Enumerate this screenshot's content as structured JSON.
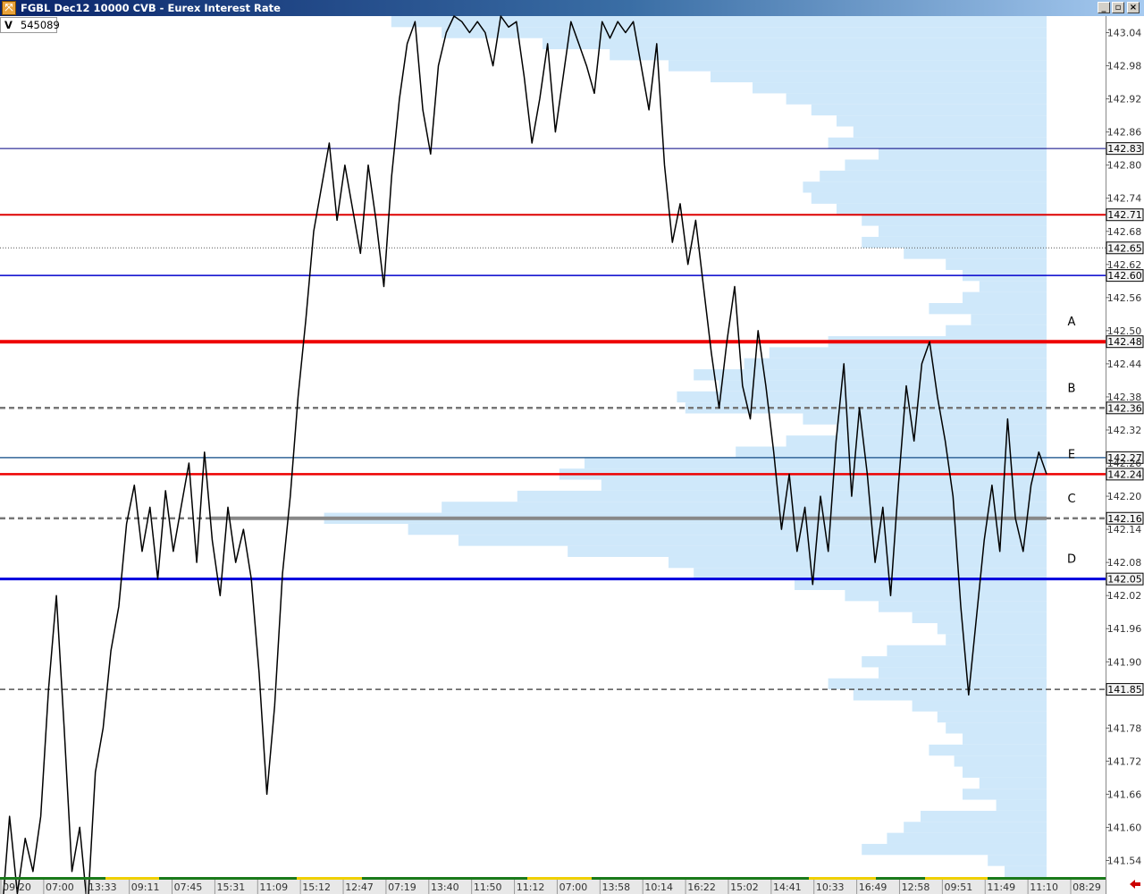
{
  "window": {
    "title": "FGBL Dec12 10000 CVB - Eurex Interest Rate",
    "minimize_glyph": "_",
    "maximize_glyph": "▫",
    "close_glyph": "×"
  },
  "volume_label": {
    "prefix": "V",
    "value": "545089"
  },
  "chart_data": {
    "type": "line",
    "instrument": "FGBL Dec12",
    "series": [
      {
        "points": [
          [
            "09:20",
            141.44
          ],
          [
            "09:20",
            141.62
          ],
          [
            "09:20",
            141.48
          ],
          [
            "09:20",
            141.58
          ],
          [
            "09:20",
            141.52
          ],
          [
            "07:00",
            141.62
          ],
          [
            "07:00",
            141.85
          ],
          [
            "07:00",
            142.02
          ],
          [
            "07:00",
            141.78
          ],
          [
            "07:00",
            141.52
          ],
          [
            "07:00",
            141.6
          ],
          [
            "07:00",
            141.45
          ],
          [
            "07:00",
            141.7
          ],
          [
            "13:33",
            141.78
          ],
          [
            "13:33",
            141.92
          ],
          [
            "13:33",
            142.0
          ],
          [
            "13:33",
            142.15
          ],
          [
            "13:33",
            142.22
          ],
          [
            "13:33",
            142.1
          ],
          [
            "13:33",
            142.18
          ],
          [
            "09:11",
            142.05
          ],
          [
            "09:11",
            142.21
          ],
          [
            "09:11",
            142.1
          ],
          [
            "09:11",
            142.18
          ],
          [
            "09:11",
            142.26
          ],
          [
            "09:11",
            142.08
          ],
          [
            "07:45",
            142.28
          ],
          [
            "07:45",
            142.12
          ],
          [
            "07:45",
            142.02
          ],
          [
            "07:45",
            142.18
          ],
          [
            "07:45",
            142.08
          ],
          [
            "15:31",
            142.14
          ],
          [
            "15:31",
            142.05
          ],
          [
            "15:31",
            141.88
          ],
          [
            "15:31",
            141.66
          ],
          [
            "15:31",
            141.82
          ],
          [
            "15:31",
            142.06
          ],
          [
            "15:31",
            142.2
          ],
          [
            "11:09",
            142.38
          ],
          [
            "11:09",
            142.52
          ],
          [
            "11:09",
            142.68
          ],
          [
            "11:09",
            142.76
          ],
          [
            "11:09",
            142.84
          ],
          [
            "11:09",
            142.7
          ],
          [
            "15:12",
            142.8
          ],
          [
            "15:12",
            142.72
          ],
          [
            "15:12",
            142.64
          ],
          [
            "15:12",
            142.8
          ],
          [
            "15:12",
            142.7
          ],
          [
            "12:47",
            142.58
          ],
          [
            "12:47",
            142.78
          ],
          [
            "12:47",
            142.92
          ],
          [
            "12:47",
            143.02
          ],
          [
            "12:47",
            143.06
          ],
          [
            "12:47",
            142.9
          ],
          [
            "07:19",
            142.82
          ],
          [
            "07:19",
            142.98
          ],
          [
            "07:19",
            143.04
          ],
          [
            "07:19",
            143.07
          ],
          [
            "13:40",
            143.06
          ],
          [
            "13:40",
            143.04
          ],
          [
            "11:50",
            143.06
          ],
          [
            "11:50",
            143.04
          ],
          [
            "11:50",
            142.98
          ],
          [
            "11:12",
            143.07
          ],
          [
            "11:12",
            143.05
          ],
          [
            "07:00",
            143.06
          ],
          [
            "07:00",
            142.96
          ],
          [
            "07:00",
            142.84
          ],
          [
            "07:00",
            142.92
          ],
          [
            "13:58",
            143.02
          ],
          [
            "13:58",
            142.86
          ],
          [
            "13:58",
            142.96
          ],
          [
            "10:14",
            143.06
          ],
          [
            "10:14",
            143.02
          ],
          [
            "10:14",
            142.98
          ],
          [
            "10:14",
            142.93
          ],
          [
            "16:22",
            143.06
          ],
          [
            "16:22",
            143.03
          ],
          [
            "15:02",
            143.06
          ],
          [
            "15:02",
            143.04
          ],
          [
            "14:41",
            143.06
          ],
          [
            "14:41",
            142.98
          ],
          [
            "14:41",
            142.9
          ],
          [
            "14:41",
            143.02
          ],
          [
            "10:33",
            142.8
          ],
          [
            "10:33",
            142.66
          ],
          [
            "10:33",
            142.73
          ],
          [
            "10:33",
            142.62
          ],
          [
            "10:33",
            142.7
          ],
          [
            "16:49",
            142.58
          ],
          [
            "16:49",
            142.46
          ],
          [
            "16:49",
            142.36
          ],
          [
            "16:49",
            142.48
          ],
          [
            "16:49",
            142.58
          ],
          [
            "16:49",
            142.4
          ],
          [
            "16:49",
            142.34
          ],
          [
            "16:49",
            142.5
          ],
          [
            "16:49",
            142.4
          ],
          [
            "12:58",
            142.28
          ],
          [
            "12:58",
            142.14
          ],
          [
            "12:58",
            142.24
          ],
          [
            "12:58",
            142.1
          ],
          [
            "12:58",
            142.18
          ],
          [
            "12:58",
            142.04
          ],
          [
            "12:58",
            142.2
          ],
          [
            "12:58",
            142.1
          ],
          [
            "09:51",
            142.3
          ],
          [
            "09:51",
            142.44
          ],
          [
            "09:51",
            142.2
          ],
          [
            "09:51",
            142.36
          ],
          [
            "09:51",
            142.24
          ],
          [
            "11:49",
            142.08
          ],
          [
            "11:49",
            142.18
          ],
          [
            "11:49",
            142.02
          ],
          [
            "11:49",
            142.22
          ],
          [
            "11:49",
            142.4
          ],
          [
            "11:49",
            142.3
          ],
          [
            "11:49",
            142.44
          ],
          [
            "11:49",
            142.48
          ],
          [
            "11:49",
            142.38
          ],
          [
            "11:49",
            142.3
          ],
          [
            "11:10",
            142.2
          ],
          [
            "11:10",
            142.0
          ],
          [
            "11:10",
            141.84
          ],
          [
            "11:10",
            141.98
          ],
          [
            "11:10",
            142.12
          ],
          [
            "11:10",
            142.22
          ],
          [
            "11:10",
            142.1
          ],
          [
            "08:29",
            142.34
          ],
          [
            "08:29",
            142.16
          ],
          [
            "08:29",
            142.1
          ],
          [
            "08:29",
            142.22
          ],
          [
            "08:29",
            142.28
          ],
          [
            "08:29",
            142.24
          ]
        ]
      }
    ],
    "x_labels": [
      "09:20",
      "07:00",
      "13:33",
      "09:11",
      "07:45",
      "15:31",
      "11:09",
      "15:12",
      "12:47",
      "07:19",
      "13:40",
      "11:50",
      "11:12",
      "07:00",
      "13:58",
      "10:14",
      "16:22",
      "15:02",
      "14:41",
      "10:33",
      "16:49",
      "12:58",
      "09:51",
      "11:49",
      "11:10",
      "08:29"
    ],
    "y_ticks": [
      "143.04",
      "142.98",
      "142.92",
      "142.86",
      "142.80",
      "142.74",
      "142.68",
      "142.62",
      "142.56",
      "142.50",
      "142.44",
      "142.38",
      "142.32",
      "142.26",
      "142.20",
      "142.14",
      "142.08",
      "142.02",
      "141.96",
      "141.90",
      "141.78",
      "141.72",
      "141.66",
      "141.60",
      "141.54"
    ],
    "ylim": [
      141.51,
      143.07
    ],
    "volume_profile": [
      [
        143.06,
        0.78
      ],
      [
        143.04,
        0.72
      ],
      [
        143.02,
        0.6
      ],
      [
        143.0,
        0.52
      ],
      [
        142.98,
        0.45
      ],
      [
        142.96,
        0.4
      ],
      [
        142.94,
        0.35
      ],
      [
        142.92,
        0.31
      ],
      [
        142.9,
        0.28
      ],
      [
        142.88,
        0.25
      ],
      [
        142.86,
        0.23
      ],
      [
        142.84,
        0.26
      ],
      [
        142.82,
        0.2
      ],
      [
        142.8,
        0.24
      ],
      [
        142.78,
        0.27
      ],
      [
        142.76,
        0.29
      ],
      [
        142.74,
        0.28
      ],
      [
        142.72,
        0.25
      ],
      [
        142.7,
        0.22
      ],
      [
        142.68,
        0.2
      ],
      [
        142.66,
        0.22
      ],
      [
        142.64,
        0.17
      ],
      [
        142.62,
        0.12
      ],
      [
        142.6,
        0.1
      ],
      [
        142.58,
        0.08
      ],
      [
        142.56,
        0.1
      ],
      [
        142.54,
        0.14
      ],
      [
        142.52,
        0.09
      ],
      [
        142.5,
        0.12
      ],
      [
        142.48,
        0.26
      ],
      [
        142.46,
        0.33
      ],
      [
        142.44,
        0.36
      ],
      [
        142.42,
        0.42
      ],
      [
        142.4,
        0.39
      ],
      [
        142.38,
        0.44
      ],
      [
        142.36,
        0.43
      ],
      [
        142.34,
        0.29
      ],
      [
        142.32,
        0.25
      ],
      [
        142.3,
        0.31
      ],
      [
        142.28,
        0.37
      ],
      [
        142.26,
        0.55
      ],
      [
        142.24,
        0.58
      ],
      [
        142.22,
        0.53
      ],
      [
        142.2,
        0.63
      ],
      [
        142.18,
        0.72
      ],
      [
        142.16,
        0.86
      ],
      [
        142.14,
        0.76
      ],
      [
        142.12,
        0.7
      ],
      [
        142.1,
        0.57
      ],
      [
        142.08,
        0.45
      ],
      [
        142.06,
        0.42
      ],
      [
        142.04,
        0.3
      ],
      [
        142.02,
        0.24
      ],
      [
        142.0,
        0.2
      ],
      [
        141.98,
        0.16
      ],
      [
        141.96,
        0.13
      ],
      [
        141.94,
        0.12
      ],
      [
        141.92,
        0.19
      ],
      [
        141.9,
        0.22
      ],
      [
        141.88,
        0.2
      ],
      [
        141.86,
        0.26
      ],
      [
        141.84,
        0.23
      ],
      [
        141.82,
        0.16
      ],
      [
        141.8,
        0.13
      ],
      [
        141.78,
        0.12
      ],
      [
        141.76,
        0.1
      ],
      [
        141.74,
        0.14
      ],
      [
        141.72,
        0.11
      ],
      [
        141.7,
        0.1
      ],
      [
        141.68,
        0.08
      ],
      [
        141.66,
        0.1
      ],
      [
        141.64,
        0.06
      ],
      [
        141.62,
        0.15
      ],
      [
        141.6,
        0.17
      ],
      [
        141.58,
        0.19
      ],
      [
        141.56,
        0.22
      ],
      [
        141.54,
        0.07
      ],
      [
        141.52,
        0.05
      ]
    ],
    "levels": [
      {
        "price": 142.83,
        "label": "142.83",
        "color": "#000080",
        "style": "solid",
        "weight": 1,
        "tag": ""
      },
      {
        "price": 142.71,
        "label": "142.71",
        "color": "#dd0000",
        "style": "solid",
        "weight": 2,
        "tag": ""
      },
      {
        "price": 142.65,
        "label": "142.65",
        "color": "#555555",
        "style": "dotted",
        "weight": 1,
        "tag": ""
      },
      {
        "price": 142.6,
        "label": "142.60",
        "color": "#0000cc",
        "style": "solid",
        "weight": 1.5,
        "tag": ""
      },
      {
        "price": 142.48,
        "label": "142.48",
        "color": "#ee0000",
        "style": "solid",
        "weight": 4,
        "tag": "A"
      },
      {
        "price": 142.36,
        "label": "142.36",
        "color": "#777777",
        "style": "dashed",
        "weight": 2.5,
        "tag": "B"
      },
      {
        "price": 142.27,
        "label": "142.27",
        "color": "#336699",
        "style": "solid",
        "weight": 1.5,
        "tag": ""
      },
      {
        "price": 142.24,
        "label": "142.24",
        "color": "#ee0000",
        "style": "solid",
        "weight": 2.5,
        "tag": "E"
      },
      {
        "price": 142.16,
        "label": "142.16",
        "color": "#777777",
        "style": "dashed",
        "weight": 2.5,
        "tag": "C"
      },
      {
        "price": 142.05,
        "label": "142.05",
        "color": "#0000dd",
        "style": "solid",
        "weight": 3,
        "tag": "D"
      },
      {
        "price": 141.85,
        "label": "141.85",
        "color": "#555555",
        "style": "dashed",
        "weight": 1.5,
        "tag": ""
      }
    ],
    "grid": false,
    "colors": {
      "price": "#000000",
      "profile": "#cfe8fa",
      "session_a": "#1a7a1a",
      "session_b": "#f0d000"
    }
  }
}
